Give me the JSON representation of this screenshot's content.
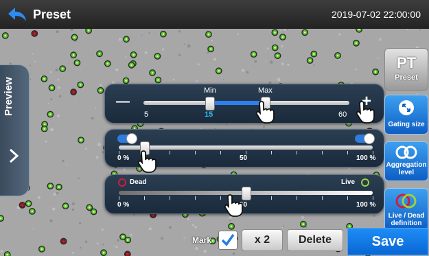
{
  "header": {
    "title": "Preset",
    "datetime": "2019-07-02 22:00:00"
  },
  "sidebar": {
    "preview_label": "Preview"
  },
  "gating": {
    "min_label": "Min",
    "max_label": "Max",
    "scale_min": "5",
    "scale_max": "60",
    "min_value": "15",
    "minus_symbol": "—",
    "plus_symbol": "+",
    "min_fraction": 0.32,
    "max_fraction": 0.59
  },
  "aggregation": {
    "scale_start": "0 %",
    "scale_mid": "50",
    "scale_end": "100 %",
    "fraction": 0.1
  },
  "livedead": {
    "dead_label": "Dead",
    "live_label": "Live",
    "scale_start": "0 %",
    "scale_mid": "50",
    "scale_end": "100 %",
    "fraction": 0.5
  },
  "side_buttons": {
    "preset_icon": "PT",
    "preset_label": "Preset",
    "gating_label": "Gating size",
    "agg_label_1": "Aggregation",
    "agg_label_2": "level",
    "live_label_1": "Live / Dead",
    "live_label_2": "definition"
  },
  "bottom": {
    "mark_label": "Mark",
    "mark_checked": true,
    "x2_label": "x 2",
    "delete_label": "Delete",
    "save_label": "Save"
  },
  "colors": {
    "accent": "#0a6fe0",
    "live": "#6fcf3a",
    "dead": "#d21c3c",
    "slider_fill": "#2d7ff0",
    "value_text": "#35b8f0"
  }
}
